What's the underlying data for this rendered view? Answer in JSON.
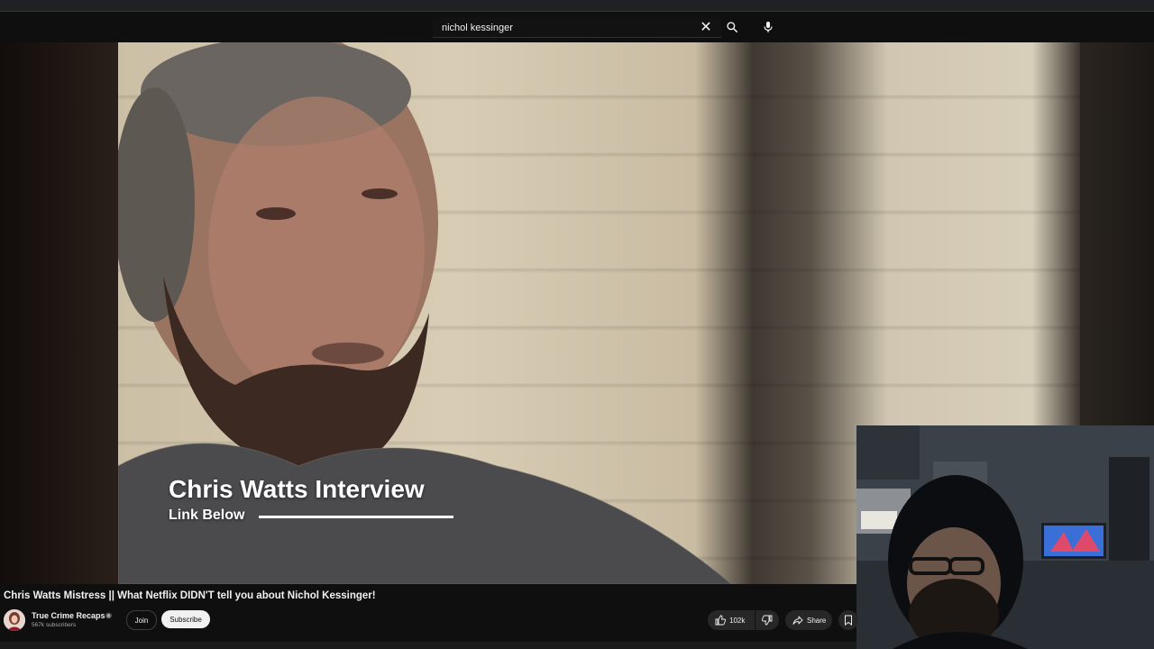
{
  "search": {
    "query": "nichol kessinger"
  },
  "icons": {
    "clear": "close-icon",
    "search": "search-icon",
    "mic": "microphone-icon",
    "like": "thumbs-up-icon",
    "dislike": "thumbs-down-icon",
    "share": "share-icon",
    "save": "bookmark-icon",
    "verified": "verified-badge-icon"
  },
  "video": {
    "overlay_title": "Chris Watts Interview",
    "overlay_subtitle": "Link Below"
  },
  "info": {
    "title": "Chris Watts Mistress || What Netflix DIDN'T tell you about Nichol Kessinger!",
    "channel_name": "True Crime Recaps",
    "subscribers": "567k subscribers",
    "join_label": "Join",
    "subscribe_label": "Subscribe",
    "like_count": "102k",
    "share_label": "Share"
  },
  "colors": {
    "background": "#0f0f0f",
    "text": "#f1f1f1",
    "button_bg": "#272727",
    "subscribe_bg": "#f1f1f1"
  }
}
